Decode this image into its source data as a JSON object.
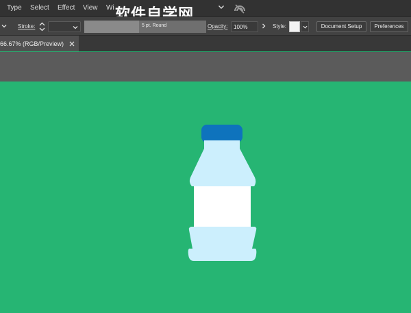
{
  "menubar": {
    "items": [
      "Type",
      "Select",
      "Effect",
      "View",
      "Wi"
    ],
    "watermark": "软件自学网"
  },
  "controlbar": {
    "stroke_label": "Stroke:",
    "brush_preset": "5 pt. Round",
    "opacity_label": "Opacity:",
    "opacity_value": "100%",
    "style_label": "Style:",
    "document_setup_label": "Document Setup",
    "preferences_label": "Preferences"
  },
  "document_tab": {
    "label": "66.67% (RGB/Preview)"
  },
  "colors": {
    "artboard": "#26b573",
    "cap": "#0e73bd",
    "bottle_body": "#cceffd",
    "label": "#ffffff",
    "canvas": "#5b5b5b",
    "ui_dark": "#323232"
  },
  "icons": {
    "stroke_stepper": "stepper-icon",
    "chevrons": "chevron-down-icon",
    "arrow": "chevron-right-icon",
    "gpu": "gpu-performance-icon",
    "close": "close-icon"
  }
}
